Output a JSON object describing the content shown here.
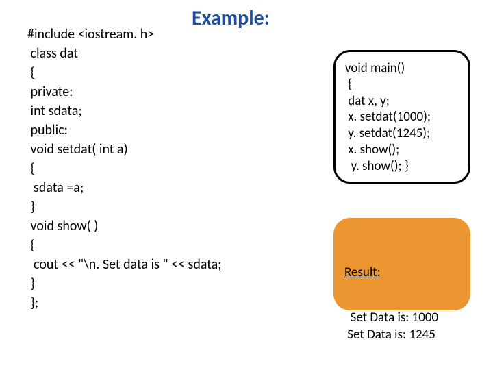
{
  "title": "Example:",
  "code_left": "#include <iostream. h>\n class dat\n {\n private:\n int sdata;\n public:\n void setdat( int a)\n {\n  sdata =a;\n }\n void show( )\n {\n  cout << \"\\n. Set data is \" << sdata;\n }\n };",
  "code_box": "void main()\n {\n dat x, y;\n x. setdat(1000);\n y. setdat(1245);\n x. show();\n  y. show(); }",
  "result_label": "Result:",
  "result_output": "Set Data is: 1000\n Set Data is: 1245"
}
